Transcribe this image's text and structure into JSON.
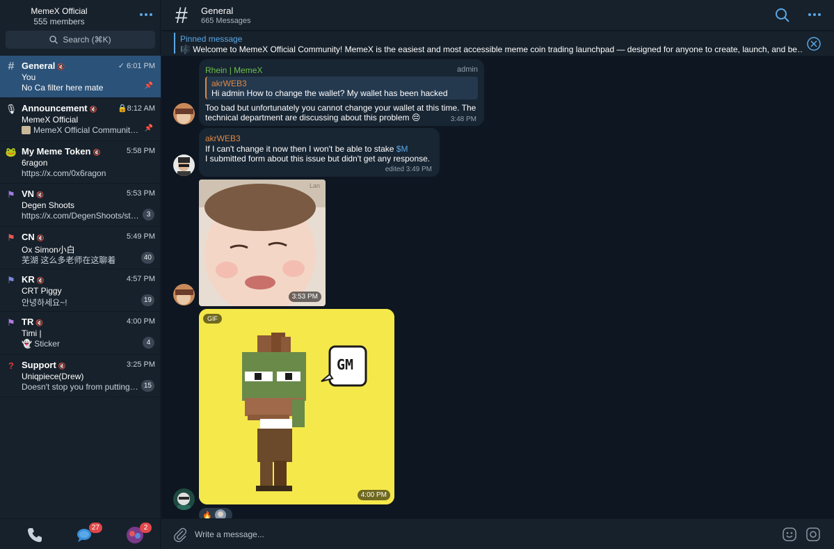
{
  "sidebar": {
    "title": "MemeX Official",
    "subtitle": "555 members",
    "search_placeholder": "Search (⌘K)",
    "chats": [
      {
        "name": "General",
        "time": "6:01 PM",
        "line2": "You",
        "line3": "No Ca filter here mate",
        "pinned": true,
        "badge": ""
      },
      {
        "name": "Announcement",
        "time": "8:12 AM",
        "line2": "MemeX Official",
        "line3": "MemeX Official Community…",
        "pinned": true,
        "badge": ""
      },
      {
        "name": "My Meme Token",
        "time": "5:58 PM",
        "line2": "6ragon",
        "line3": "https://x.com/0x6ragon",
        "pinned": false,
        "badge": ""
      },
      {
        "name": "VN",
        "time": "5:53 PM",
        "line2": "Degen Shoots",
        "line3": "https://x.com/DegenShoots/st…",
        "pinned": false,
        "badge": "3"
      },
      {
        "name": "CN",
        "time": "5:49 PM",
        "line2": "Ox Simon小白",
        "line3": "芜湖 这么多老师在这聊着",
        "pinned": false,
        "badge": "40"
      },
      {
        "name": "KR",
        "time": "4:57 PM",
        "line2": "CRT Piggy",
        "line3": "안녕하세요~!",
        "pinned": false,
        "badge": "19"
      },
      {
        "name": "TR",
        "time": "4:00 PM",
        "line2": "Timi |",
        "line3": "Sticker",
        "pinned": false,
        "badge": "4"
      },
      {
        "name": "Support",
        "time": "3:25 PM",
        "line2": "Uniqpiece(Drew)",
        "line3": "Doesn't stop you from putting…",
        "pinned": false,
        "badge": "15"
      }
    ],
    "bottom": {
      "chats_badge": "27",
      "contacts_badge": "2"
    }
  },
  "header": {
    "title": "General",
    "subtitle": "665 Messages"
  },
  "pinned": {
    "label": "Pinned message",
    "text": "Welcome to MemeX Official Community!  MemeX is the easiest and most accessible meme coin trading launchpad — designed for anyone to create, launch, and be…"
  },
  "messages": {
    "m1": {
      "author": "Rhein | MemeX",
      "role": "admin",
      "quote_author": "akrWEB3",
      "quote_text": "Hi admin  How to change the wallet? My wallet has been hacked",
      "text1": "Too bad but unfortunately you cannot change your wallet at this time. The",
      "text2": "technical department are discussing about this problem 😔",
      "time": "3:48 PM"
    },
    "m2": {
      "author": "akrWEB3",
      "text1a": "If I can't change it now then I won't be able to stake ",
      "mention": "$M",
      "text2": "I submitted form about this issue but didn't get any response.",
      "time": "edited 3:49 PM"
    },
    "m3": {
      "time": "3:53 PM",
      "watermark": "Lan"
    },
    "m4": {
      "gif_label": "GIF",
      "time": "4:00 PM",
      "sticker_text": "GM"
    },
    "reaction": "🔥"
  },
  "composer": {
    "placeholder": "Write a message..."
  },
  "colors": {
    "accent": "#5aa8e8",
    "active_chat": "#2b5278",
    "bubble": "#182533",
    "admin_name": "#6cc04a",
    "user_name": "#e08a45"
  }
}
